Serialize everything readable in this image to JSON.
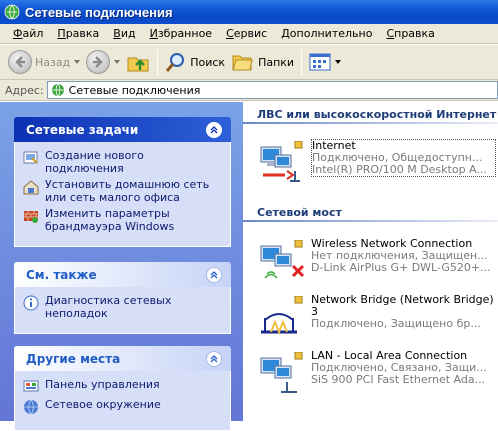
{
  "window": {
    "title": "Сетевые подключения"
  },
  "menu": [
    {
      "label": "Файл",
      "u": "Ф",
      "rest": "айл"
    },
    {
      "label": "Правка",
      "u": "П",
      "rest": "равка"
    },
    {
      "label": "Вид",
      "u": "В",
      "rest": "ид"
    },
    {
      "label": "Избранное",
      "u": "И",
      "rest": "збранное"
    },
    {
      "label": "Сервис",
      "u": "С",
      "rest": "ервис"
    },
    {
      "label": "Дополнительно",
      "u": "Д",
      "rest": "ополнительно"
    },
    {
      "label": "Справка",
      "u": "С",
      "rest": "правка"
    }
  ],
  "toolbar": {
    "back_label": "Назад",
    "search_label": "Поиск",
    "folders_label": "Папки"
  },
  "address": {
    "label": "Адрес:",
    "value": "Сетевые подключения"
  },
  "tasks": {
    "title": "Сетевые задачи",
    "items": [
      {
        "label": "Создание нового подключения",
        "icon": "new-connection-icon"
      },
      {
        "label": "Установить домашнюю сеть или сеть малого офиса",
        "icon": "home-network-icon"
      },
      {
        "label": "Изменить параметры брандмауэра Windows",
        "icon": "firewall-icon"
      }
    ]
  },
  "see_also": {
    "title": "См. также",
    "items": [
      {
        "label": "Диагностика сетевых неполадок",
        "icon": "info-icon"
      }
    ]
  },
  "other_places": {
    "title": "Другие места",
    "items": [
      {
        "label": "Панель управления",
        "icon": "control-panel-icon"
      },
      {
        "label": "Сетевое окружение",
        "icon": "network-places-icon"
      }
    ]
  },
  "groups": {
    "lan_title": "ЛВС или высокоскоростной Интернет",
    "bridge_title": "Сетевой мост"
  },
  "connections": {
    "internet": {
      "name": "Internet",
      "status": "Подключено, Общедоступн...",
      "device": "Intel(R) PRO/100 M Desktop A..."
    },
    "wireless": {
      "name": "Wireless Network Connection",
      "status": "Нет подключения, Защищен...",
      "device": "D-Link AirPlus G+ DWL-G520+..."
    },
    "bridge": {
      "name": "Network Bridge (Network Bridge)",
      "status": "3",
      "device": "Подключено, Защищено бр..."
    },
    "lan": {
      "name": "LAN - Local Area Connection",
      "status": "Подключено, Связано, Защи...",
      "device": "SiS 900 PCI Fast Ethernet Ada..."
    }
  },
  "colors": {
    "titlebar": "#0a48c8",
    "task_pane": "#7ba2e7",
    "task_header": "#0c32b4"
  }
}
